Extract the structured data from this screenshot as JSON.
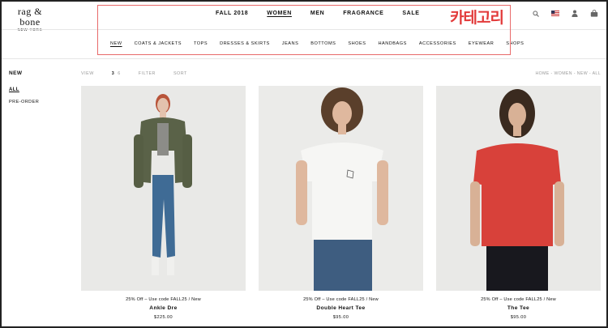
{
  "header": {
    "logo_main": "rag & bone",
    "logo_sub": "NEW YORK",
    "top_nav": [
      "FALL 2018",
      "WOMEN",
      "MEN",
      "FRAGRANCE",
      "SALE"
    ],
    "annotation_label": "카테고리",
    "icons": [
      "search-icon",
      "us-flag-icon",
      "account-icon",
      "bag-icon"
    ]
  },
  "sub_nav": [
    "NEW",
    "COATS & JACKETS",
    "TOPS",
    "DRESSES & SKIRTS",
    "JEANS",
    "BOTTOMS",
    "SHOES",
    "HANDBAGS",
    "ACCESSORIES",
    "EYEWEAR",
    "SHOPS"
  ],
  "sidebar": {
    "title": "NEW",
    "items": [
      "ALL",
      "PRE-ORDER"
    ]
  },
  "toolbar": {
    "view_label": "VIEW",
    "view_options": [
      "3",
      "6"
    ],
    "filter_label": "FILTER",
    "sort_label": "SORT",
    "breadcrumb": "HOME - WOMEN - NEW - ALL"
  },
  "products": [
    {
      "promo": "25% Off – Use code FALL25 / New",
      "name": "Ankle Dre",
      "price": "$225.00",
      "color": "#5a6248"
    },
    {
      "promo": "25% Off – Use code FALL25 / New",
      "name": "Double Heart Tee",
      "price": "$95.00",
      "color": "#f4f4f2"
    },
    {
      "promo": "25% Off – Use code FALL25 / New",
      "name": "The Tee",
      "price": "$95.00",
      "color": "#d8413a"
    }
  ],
  "colors": {
    "annotation": "#e23a3a",
    "muted_text": "#9a9a9a"
  }
}
